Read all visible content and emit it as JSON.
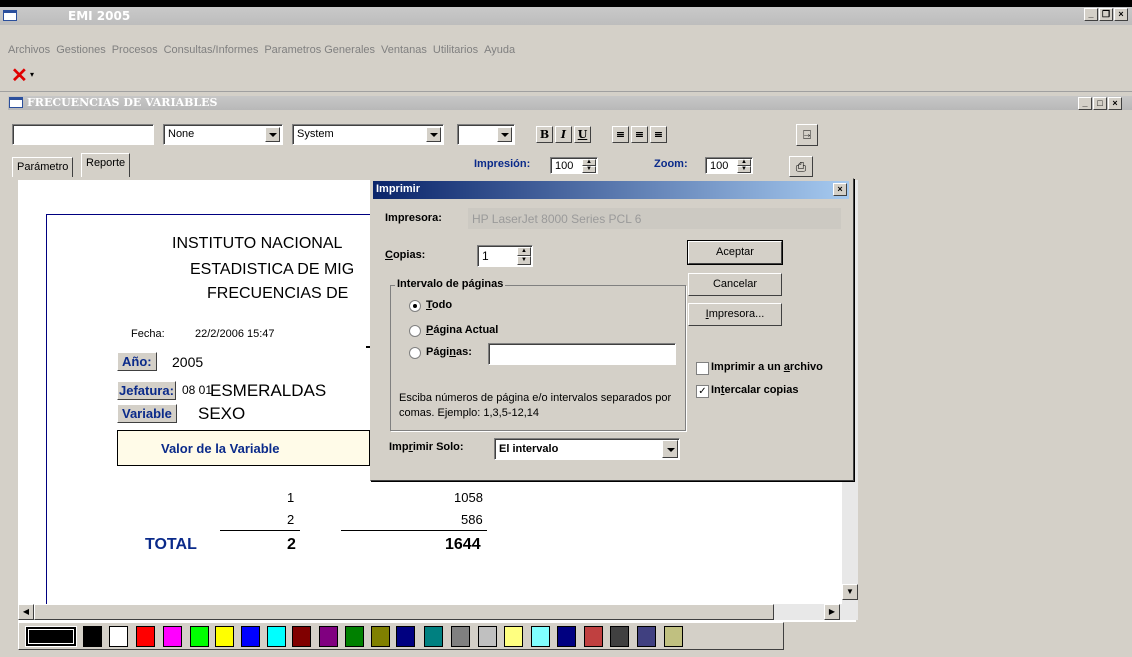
{
  "app": {
    "title": "EMI 2005"
  },
  "menu": [
    "Archivos",
    "Gestiones",
    "Procesos",
    "Consultas/Informes",
    "Parametros Generales",
    "Ventanas",
    "Utilitarios",
    "Ayuda"
  ],
  "child_window": {
    "title": "FRECUENCIAS DE VARIABLES"
  },
  "format_toolbar": {
    "text_value": "",
    "combo1": "None",
    "combo2": "System",
    "combo3": "",
    "bold": "B",
    "italic": "I",
    "underline": "U"
  },
  "tabs": [
    "Parámetro",
    "Reporte"
  ],
  "print_zoom": {
    "impresion_label": "Impresión:",
    "impresion_value": "100",
    "zoom_label": "Zoom:",
    "zoom_value": "100"
  },
  "report": {
    "title1": "INSTITUTO NACIONAL",
    "title2": "ESTADISTICA DE MIG",
    "title3": "FRECUENCIAS DE",
    "fecha_label": "Fecha:",
    "fecha_value": "22/2/2006  15:47",
    "anio_label": "Año:",
    "anio_value": "2005",
    "jefatura_label": "Jefatura:",
    "jefatura_code": "08 01",
    "jefatura_value": "ESMERALDAS",
    "variable_label": "Variable",
    "variable_value": "SEXO",
    "col_header": "Valor de la Variable",
    "rows": [
      {
        "valor": "1",
        "frecuencia": "1058"
      },
      {
        "valor": "2",
        "frecuencia": "586"
      }
    ],
    "total_label": "TOTAL",
    "total_valor": "2",
    "total_frecuencia": "1644"
  },
  "palette": [
    "#000000",
    "#000000",
    "#ffffff",
    "#ff0000",
    "#ff00ff",
    "#00ff00",
    "#ffff00",
    "#0000ff",
    "#00ffff",
    "#800000",
    "#800080",
    "#008000",
    "#808000",
    "#000080",
    "#008080",
    "#808080",
    "#c0c0c0",
    "#ffff80",
    "#80ffff",
    "#000080",
    "#c04040",
    "#404040",
    "#404080",
    "#c0c080"
  ],
  "print_dialog": {
    "title": "Imprimir",
    "impresora_label": "Impresora:",
    "impresora_value": "HP LaserJet 8000 Series PCL 6",
    "copias_label": "Copias:",
    "copias_value": "1",
    "group_label": "Intervalo de páginas",
    "radio_todo": "Todo",
    "radio_actual": "Página Actual",
    "radio_paginas": "Páginas:",
    "paginas_value": "",
    "hint": "Esciba números de página e/o intervalos separados por comas. Ejemplo: 1,3,5-12,14",
    "imprimir_solo_label": "Imprimir Solo:",
    "imprimir_solo_value": "El intervalo",
    "aceptar": "Aceptar",
    "cancelar": "Cancelar",
    "impresora_btn": "Impresora...",
    "chk_archivo": "Imprimir a un archivo",
    "chk_archivo_checked": false,
    "chk_intercalar": "Intercalar copias",
    "chk_intercalar_checked": true
  }
}
